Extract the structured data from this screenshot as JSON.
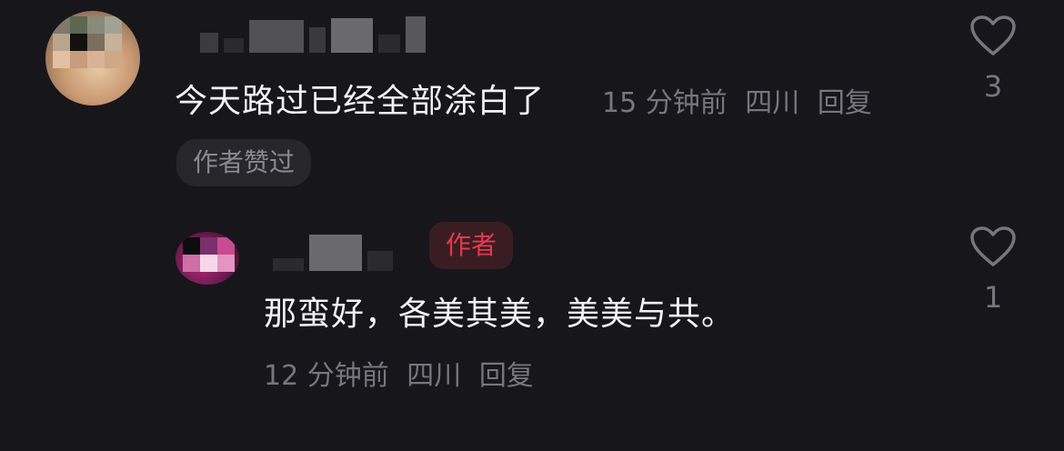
{
  "comments": {
    "main": {
      "text": "今天路过已经全部涂白了",
      "time": "15 分钟前",
      "location": "四川",
      "reply_label": "回复",
      "like_count": "3",
      "author_liked_label": "作者赞过"
    },
    "reply": {
      "author_badge": "作者",
      "text": "那蛮好，各美其美，美美与共。",
      "time": "12 分钟前",
      "location": "四川",
      "reply_label": "回复",
      "like_count": "1"
    }
  },
  "icons": {
    "like": "heart-outline-icon"
  },
  "colors": {
    "background": "#17161b",
    "text": "#f2f2f4",
    "meta": "#77767c",
    "author_badge": "#e8374f"
  }
}
